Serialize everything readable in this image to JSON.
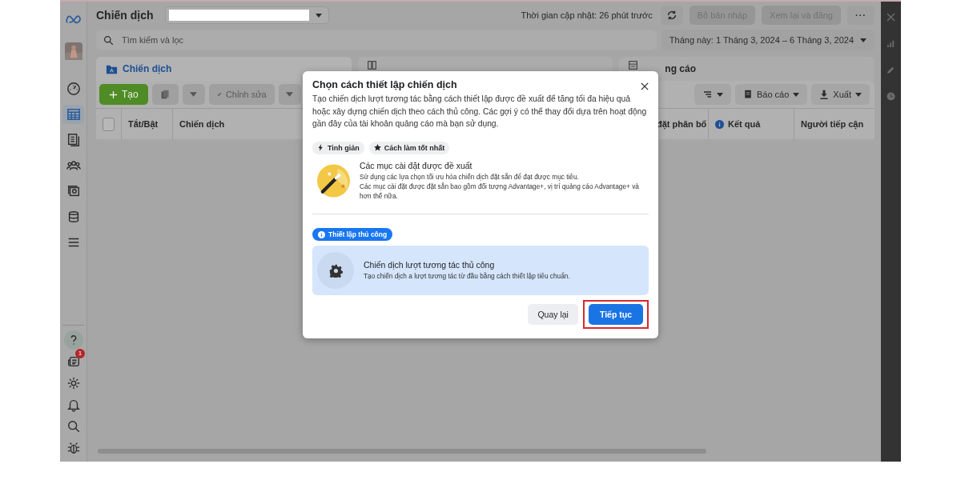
{
  "sidebar": {
    "items": [
      {
        "kind": "gauge",
        "selected": false
      },
      {
        "kind": "table",
        "selected": true
      },
      {
        "kind": "pages",
        "selected": false
      },
      {
        "kind": "people",
        "selected": false
      },
      {
        "kind": "gallery",
        "selected": false
      },
      {
        "kind": "stack",
        "selected": false
      },
      {
        "kind": "menu",
        "selected": false
      }
    ],
    "bottom_items": [
      {
        "kind": "help",
        "selected": true
      },
      {
        "kind": "news",
        "badge": "1",
        "selected": false
      },
      {
        "kind": "gear",
        "selected": false
      },
      {
        "kind": "bell",
        "selected": false
      },
      {
        "kind": "search",
        "selected": false
      },
      {
        "kind": "bug",
        "selected": false
      }
    ]
  },
  "header": {
    "title": "Chiến dịch",
    "updated": "Thời gian cập nhật: 26 phút trước",
    "buttons": [
      {
        "label": "Bỏ bản nháp",
        "disabled": true
      },
      {
        "label": "Xem lại và đăng",
        "disabled": true
      }
    ],
    "more": "···"
  },
  "search": {
    "placeholder": "Tìm kiếm và lọc"
  },
  "date_range": "Tháng này: 1 Tháng 3, 2024 – 6 Tháng 3, 2024",
  "tabs": [
    {
      "kind": "campaign",
      "label": "Chiến dịch",
      "selected": true
    },
    {
      "kind": "adset"
    },
    {
      "kind": "ad",
      "label": "ng cáo",
      "selected": false
    }
  ],
  "toolbar": {
    "create": "Tạo",
    "edit": "Chỉnh sửa",
    "report": "Báo cáo",
    "export": "Xuất"
  },
  "table": {
    "columns": [
      {
        "kind": "check",
        "checked": false
      },
      {
        "kind": "text",
        "label": "Tắt/Bật"
      },
      {
        "kind": "text",
        "label": "Chiến dịch"
      },
      {
        "kind": "text",
        "label": "đặt phân bổ"
      },
      {
        "kind": "info",
        "label": "Kết quả"
      },
      {
        "kind": "text",
        "label": "Người tiếp cận"
      }
    ]
  },
  "dialog": {
    "title": "Chọn cách thiết lập chiến dịch",
    "description": "Tạo chiến dịch lượt tương tác bằng cách thiết lập được đề xuất để tăng tối đa hiệu quả hoặc xây dựng chiến dịch theo cách thủ công. Các gợi ý có thể thay đổi dựa trên hoạt động gần đây của tài khoản quảng cáo mà bạn sử dụng.",
    "tags": [
      {
        "kind": "bolt",
        "label": "Tinh giản"
      },
      {
        "kind": "star",
        "label": "Cách làm tốt nhất"
      }
    ],
    "options": [
      {
        "kind": "recommended",
        "title": "Các mục cài đặt được đề xuất",
        "lines": [
          "Sử dụng các lựa chọn tối ưu hóa chiến dịch đặt sẵn để đạt được mục tiêu.",
          "Các mục cài đặt được đặt sẵn bao gồm đối tượng Advantage+, vị trí quảng cáo Advantage+ và hơn thế nữa."
        ],
        "selected": false
      },
      {
        "kind": "manual",
        "badge": "Thiết lập thủ công",
        "title": "Chiến dịch lượt tương tác thủ công",
        "lines": [
          "Tạo chiến dịch a lượt tương tác từ đầu bằng cách thiết lập tiêu chuẩn."
        ],
        "selected": true
      }
    ],
    "back": "Quay lại",
    "continue": "Tiếp tục",
    "continue_highlighted": true
  }
}
